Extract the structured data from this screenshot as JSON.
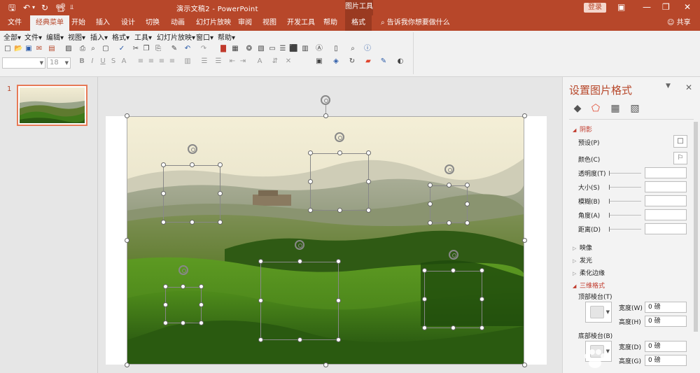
{
  "titlebar": {
    "title": "演示文稿2  -  PowerPoint",
    "tool_group": "图片工具",
    "login": "登录",
    "quick_access": {
      "save_icon": "save-icon",
      "undo_icon": "undo-icon",
      "redo_icon": "redo-icon",
      "start_icon": "slideshow-start-icon",
      "customize_icon": "customize-icon"
    }
  },
  "tabs": [
    "文件",
    "经典菜单",
    "开始",
    "插入",
    "设计",
    "切换",
    "动画",
    "幻灯片放映",
    "审阅",
    "视图",
    "开发工具",
    "帮助",
    "格式"
  ],
  "tellme": "告诉我你想要做什么",
  "share": "共享",
  "menubar": [
    "全部",
    "文件",
    "编辑",
    "视图",
    "插入",
    "格式",
    "工具",
    "幻灯片放映",
    "窗口",
    "帮助"
  ],
  "font": {
    "name": "",
    "size": "18"
  },
  "thumbnails": {
    "slide_number": "1"
  },
  "pane": {
    "title": "设置图片格式",
    "tabs": [
      "fill-line-icon",
      "effects-icon",
      "size-properties-icon",
      "picture-icon"
    ],
    "shadow": {
      "label": "阴影",
      "props": {
        "preset": "预设(P)",
        "color": "颜色(C)",
        "transparency": "透明度(T)",
        "size": "大小(S)",
        "blur": "模糊(B)",
        "angle": "角度(A)",
        "distance": "距离(D)"
      }
    },
    "sections": {
      "reflection": "映像",
      "glow": "发光",
      "soft_edges": "柔化边缘",
      "format_3d": "三维格式"
    },
    "bevel": {
      "top": "顶部棱台(T)",
      "bottom": "底部棱台(B)",
      "width": "宽度(W)",
      "height": "高度(H)",
      "width_d": "宽度(D)",
      "height_g": "高度(G)",
      "top_width": "0 磅",
      "top_height": "0 磅",
      "bottom_width": "0 磅",
      "bottom_height": "0 磅"
    }
  },
  "colors": {
    "accent": "#b7472a",
    "tool_tab": "#9a3a21",
    "pane_title": "#b7472a",
    "selected_border": "#e77a56"
  }
}
